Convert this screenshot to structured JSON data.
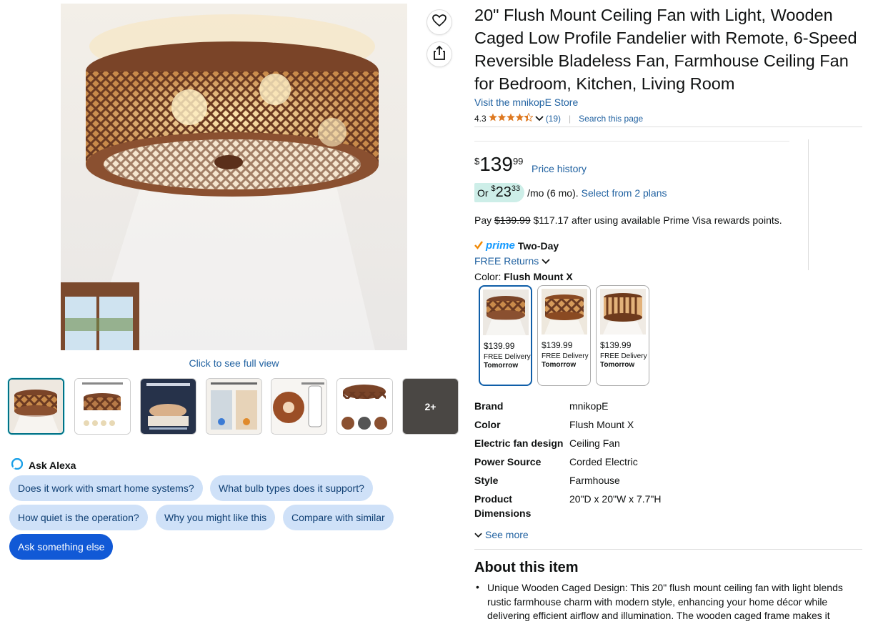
{
  "gallery": {
    "click_full_view": "Click to see full view",
    "more_thumbs": "2+"
  },
  "alexa": {
    "label": "Ask Alexa",
    "suggestions": [
      "Does it work with smart home systems?",
      "What bulb types does it support?",
      "How quiet is the operation?",
      "Why you might like this",
      "Compare with similar"
    ],
    "ask_else": "Ask something else"
  },
  "product": {
    "title": "20\" Flush Mount Ceiling Fan with Light, Wooden Caged Low Profile Fandelier with Remote, 6-Speed Reversible Bladeless Fan, Farmhouse Ceiling Fan for Bedroom, Kitchen, Living Room",
    "store": "Visit the mnikopE Store",
    "rating": "4.3",
    "stars": 4.3,
    "review_count": "(19)",
    "search_page": "Search this page"
  },
  "price": {
    "symbol": "$",
    "whole": "139",
    "fraction": "99",
    "history": "Price history",
    "monthly_prefix": "Or",
    "monthly_symbol": "$",
    "monthly_whole": "23",
    "monthly_fraction": "33",
    "monthly_term": "/mo (6 mo).",
    "monthly_link": "Select from 2 plans",
    "pay_prefix": "Pay",
    "pay_old": "$139.99",
    "pay_rest": "$117.17 after using available Prime Visa rewards points."
  },
  "delivery": {
    "prime": "prime",
    "two_day": "Two-Day",
    "returns": "FREE Returns"
  },
  "color": {
    "label": "Color:",
    "selected": "Flush Mount X",
    "options": [
      {
        "price": "$139.99",
        "delivery": "FREE Delivery",
        "when": "Tomorrow"
      },
      {
        "price": "$139.99",
        "delivery": "FREE Delivery",
        "when": "Tomorrow"
      },
      {
        "price": "$139.99",
        "delivery": "FREE Delivery",
        "when": "Tomorrow"
      }
    ]
  },
  "specs": [
    {
      "k": "Brand",
      "v": "mnikopE"
    },
    {
      "k": "Color",
      "v": "Flush Mount X"
    },
    {
      "k": "Electric fan design",
      "v": "Ceiling Fan"
    },
    {
      "k": "Power Source",
      "v": "Corded Electric"
    },
    {
      "k": "Style",
      "v": "Farmhouse"
    },
    {
      "k": "Product Dimensions",
      "v": "20\"D x 20\"W x 7.7\"H"
    }
  ],
  "see_more": "See more",
  "about": {
    "heading": "About this item",
    "bullet1": "Unique Wooden Caged Design: This 20\" flush mount ceiling fan with light blends rustic farmhouse charm with modern style, enhancing your home décor while delivering efficient airflow and illumination. The wooden caged frame makes it"
  },
  "colors": {
    "link": "#2162a1",
    "selected_border": "#0f5ea8",
    "star": "#de7921",
    "alexa_pill": "#cfe1f8",
    "ask_else": "#1159d6"
  }
}
